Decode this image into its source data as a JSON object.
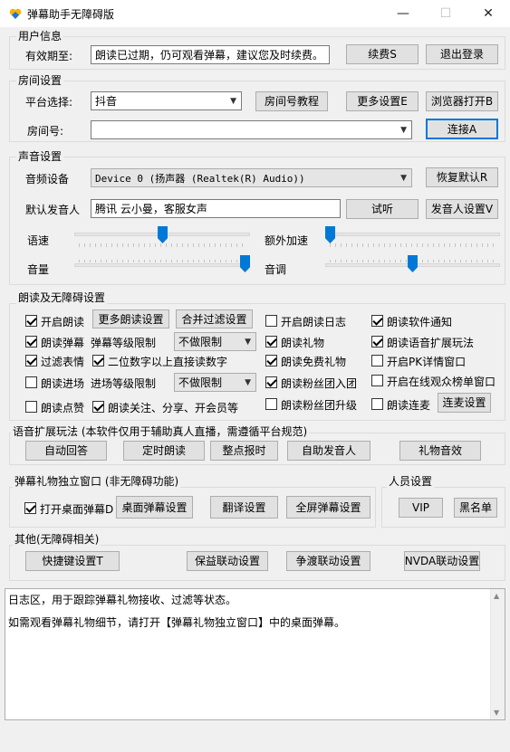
{
  "window": {
    "title": "弹幕助手无障碍版",
    "min": "—",
    "max": "☐",
    "close": "✕"
  },
  "user": {
    "group": "用户信息",
    "expiry_label": "有效期至:",
    "expiry_value": "朗读已过期，仍可观看弹幕，建议您及时续费。",
    "renew": "续费S",
    "logout": "退出登录"
  },
  "room": {
    "group": "房间设置",
    "platform_label": "平台选择:",
    "platform_value": "抖音",
    "tutorial": "房间号教程",
    "more": "更多设置E",
    "browser": "浏览器打开B",
    "room_label": "房间号:",
    "room_value": "",
    "connect": "连接A"
  },
  "sound": {
    "group": "声音设置",
    "device_label": "音频设备",
    "device_value": "Device 0 (扬声器 (Realtek(R) Audio))",
    "restore": "恢复默认R",
    "voice_label": "默认发音人",
    "voice_value": "腾讯 云小曼，客服女声",
    "listen": "试听",
    "voice_settings": "发音人设置V",
    "speed": "语速",
    "extra_speed": "额外加速",
    "volume": "音量",
    "pitch": "音调",
    "speed_level": 0.5,
    "extra_speed_level": 0.0,
    "volume_level": 1.0,
    "pitch_level": 0.5
  },
  "reading": {
    "group": "朗读及无障碍设置",
    "enable_read": "开启朗读",
    "more_read": "更多朗读设置",
    "merge_filter": "合并过滤设置",
    "read_log": "开启朗读日志",
    "software_notice": "朗读软件通知",
    "read_danmaku": "朗读弹幕",
    "danmaku_level_label": "弹幕等级限制",
    "danmaku_level_value": "不做限制",
    "read_gift": "朗读礼物",
    "voice_ext": "朗读语音扩展玩法",
    "filter_emoji": "过滤表情",
    "two_digit": "二位数字以上直接读数字",
    "read_free_gift": "朗读免费礼物",
    "pk_window": "开启PK详情窗口",
    "read_enter": "朗读进场",
    "enter_level_label": "进场等级限制",
    "enter_level_value": "不做限制",
    "fan_join": "朗读粉丝团入团",
    "online_rank": "开启在线观众榜单窗口",
    "read_like": "朗读点赞",
    "read_follow": "朗读关注、分享、开会员等",
    "fan_upgrade": "朗读粉丝团升级",
    "read_mic": "朗读连麦",
    "mic_settings": "连麦设置"
  },
  "voice_ext": {
    "group": "语音扩展玩法 (本软件仅用于辅助真人直播，需遵循平台规范)",
    "auto_reply": "自动回答",
    "timed_read": "定时朗读",
    "hourly": "整点报时",
    "auto_voice": "自助发音人",
    "gift_sound": "礼物音效"
  },
  "danmaku_window": {
    "group": "弹幕礼物独立窗口 (非无障碍功能)",
    "open_desktop": "打开桌面弹幕D",
    "desktop_settings": "桌面弹幕设置",
    "translate": "翻译设置",
    "fullscreen": "全屏弹幕设置"
  },
  "people": {
    "group": "人员设置",
    "vip": "VIP",
    "blacklist": "黑名单"
  },
  "other": {
    "group": "其他(无障碍相关)",
    "hotkeys": "快捷键设置T",
    "insurance": "保益联动设置",
    "zhengdu": "争渡联动设置",
    "nvda": "NVDA联动设置"
  },
  "log": {
    "line1": "日志区，用于跟踪弹幕礼物接收、过滤等状态。",
    "line2": "如需观看弹幕礼物细节，请打开【弹幕礼物独立窗口】中的桌面弹幕。"
  },
  "checks": {
    "enable_read": true,
    "read_log": false,
    "software_notice": true,
    "read_danmaku": true,
    "read_gift": true,
    "voice_ext": true,
    "filter_emoji": true,
    "two_digit": true,
    "read_free_gift": true,
    "pk_window": false,
    "read_enter": false,
    "fan_join": true,
    "online_rank": false,
    "read_like": false,
    "read_follow": true,
    "fan_upgrade": false,
    "read_mic": false,
    "open_desktop": true
  },
  "colors": {
    "accent": "#0078d7",
    "window_bg": "#f0f0f0"
  },
  "icons": {
    "app": "heart-shield-icon",
    "combo_arrow": "chevron-down-icon"
  }
}
